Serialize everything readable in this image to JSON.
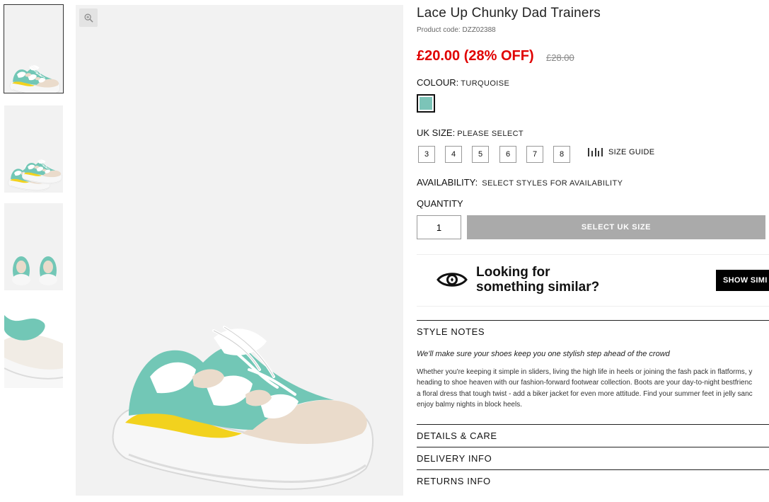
{
  "product": {
    "title": "Lace Up Chunky Dad Trainers",
    "code": "Product code: DZZ02388",
    "price": "£20.00 (28% OFF)",
    "old_price": "£28.00"
  },
  "colour": {
    "label": "COLOUR:",
    "value": "TURQUOISE",
    "swatch_color": "#7cc4b8"
  },
  "size": {
    "label": "UK SIZE:",
    "value": "PLEASE SELECT",
    "options": [
      "3",
      "4",
      "5",
      "6",
      "7",
      "8"
    ],
    "guide_label": "SIZE GUIDE"
  },
  "availability": {
    "label": "AVAILABILITY:",
    "value": "SELECT STYLES FOR AVAILABILITY"
  },
  "quantity": {
    "label": "QUANTITY",
    "value": "1"
  },
  "add_button": "SELECT UK SIZE",
  "similar": {
    "line1": "Looking for",
    "line2": "something similar?",
    "button": "SHOW SIMI"
  },
  "sections": {
    "style_notes": "STYLE NOTES",
    "tagline": "We'll make sure your shoes keep you one stylish step ahead of the crowd",
    "description": [
      "Whether you're keeping it simple in sliders, living the high life in heels or joining the fash pack in flatforms, y",
      "heading to shoe heaven with our fashion-forward footwear collection. Boots are your day-to-night bestfrienc",
      "a floral dress that tough twist - add a biker jacket for even more attitude. Find your summer feet in jelly sanc",
      "enjoy balmy nights in block heels."
    ],
    "details": "DETAILS & CARE",
    "delivery": "DELIVERY INFO",
    "returns": "RETURNS INFO"
  },
  "icons": {
    "zoom": "zoom-in-icon",
    "size_guide": "ruler-icon",
    "eye": "eye-icon"
  },
  "colors": {
    "price_red": "#e00000",
    "button_grey": "#aaaaaa",
    "turquoise": "#7cc4b8",
    "yellow": "#f2d21e",
    "beige": "#eadbcb"
  }
}
